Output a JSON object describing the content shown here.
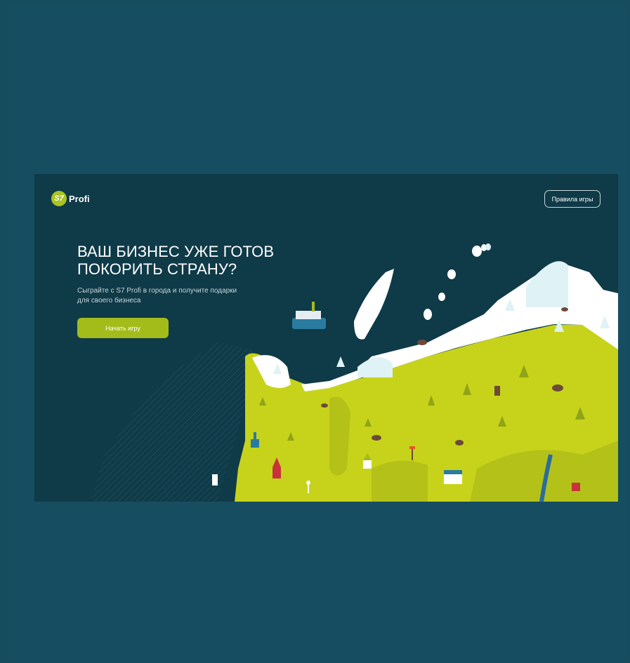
{
  "page": {
    "background": "#174c5e",
    "hero_background": "#0f3a48"
  },
  "logo": {
    "mark": "S7",
    "text": "Profi",
    "mark_color": "#a9c421"
  },
  "header": {
    "rules_button_label": "Правила игры"
  },
  "hero": {
    "headline_line1": "ВАШ БИЗНЕС УЖЕ ГОТОВ",
    "headline_line2": "ПОКОРИТЬ СТРАНУ?",
    "subtitle_line1": "Сыграйте с S7 Profi в города и получите подарки",
    "subtitle_line2": "для своего бизнеса",
    "start_button_label": "Начать игру",
    "accent_color": "#a4bc1a"
  },
  "map": {
    "land_color": "#c7d31a",
    "snow_color": "#ffffff",
    "ice_color": "#dff2f6",
    "icons": [
      "ship-icon",
      "tree-icon",
      "animal-icon",
      "monument-icon",
      "church-icon",
      "theater-icon",
      "windmill-icon",
      "lighthouse-icon",
      "gate-icon",
      "signpost-icon"
    ]
  }
}
